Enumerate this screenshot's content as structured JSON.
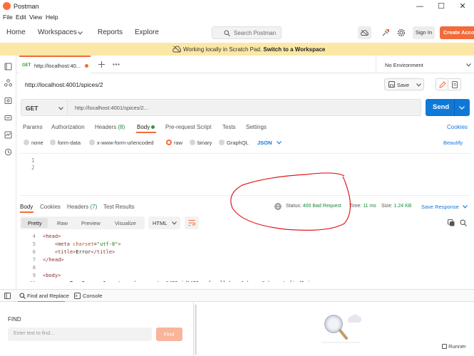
{
  "window": {
    "title": "Postman"
  },
  "menu": [
    "File",
    "Edit",
    "View",
    "Help"
  ],
  "header": {
    "nav": [
      "Home",
      "Workspaces",
      "Reports",
      "Explore"
    ],
    "search_placeholder": "Search Postman",
    "sign_in": "Sign In",
    "create_account": "Create Account"
  },
  "banner": {
    "text": "Working locally in Scratch Pad.",
    "link": "Switch to a Workspace"
  },
  "tab": {
    "method": "GET",
    "label": "http://localhost:40...",
    "environment": "No Environment"
  },
  "request": {
    "title": "http://localhost:4001/spices/2",
    "save_label": "Save",
    "method": "GET",
    "url": "http://localhost:4001/spices/2...",
    "send_label": "Send",
    "tabs": {
      "params": "Params",
      "authorization": "Authorization",
      "headers": "Headers",
      "headers_count": "(8)",
      "body": "Body",
      "prescript": "Pre-request Script",
      "tests": "Tests",
      "settings": "Settings",
      "cookies": "Cookies"
    },
    "body_types": [
      "none",
      "form-data",
      "x-www-form-urlencoded",
      "raw",
      "binary",
      "GraphQL"
    ],
    "body_format": "JSON",
    "beautify": "Beautify",
    "editor_lines": [
      "1",
      "2"
    ]
  },
  "response": {
    "tabs": {
      "body": "Body",
      "cookies": "Cookies",
      "headers": "Headers",
      "headers_count": "(7)",
      "test_results": "Test Results"
    },
    "status_label": "Status:",
    "status_value": "400 Bad Request",
    "time_label": "Time:",
    "time_value": "11 ms",
    "size_label": "Size:",
    "size_value": "1.24 KB",
    "save_response": "Save Response",
    "views": [
      "Pretty",
      "Raw",
      "Preview",
      "Visualize"
    ],
    "format": "HTML",
    "code": [
      {
        "n": "4",
        "parts": [
          [
            "tag",
            "<head>"
          ]
        ]
      },
      {
        "n": "5",
        "parts": [
          [
            "tag",
            "    <meta "
          ],
          [
            "attr",
            "charset"
          ],
          [
            "txt",
            "="
          ],
          [
            "str",
            "\"utf-8\""
          ],
          [
            "tag",
            ">"
          ]
        ]
      },
      {
        "n": "6",
        "parts": [
          [
            "tag",
            "    <title>"
          ],
          [
            "txt",
            "Error"
          ],
          [
            "tag",
            "</title>"
          ]
        ]
      },
      {
        "n": "7",
        "parts": [
          [
            "tag",
            "</head>"
          ]
        ]
      },
      {
        "n": "8",
        "parts": [
          [
            "txt",
            ""
          ]
        ]
      },
      {
        "n": "9",
        "parts": [
          [
            "tag",
            "<body>"
          ]
        ]
      },
      {
        "n": "10",
        "parts": [
          [
            "txt",
            "    <pre>TypeError: Cannot read property &#39;id&#39; of null<br> &nbsp; &nbsp;at findSpice"
          ]
        ]
      }
    ]
  },
  "bottom": {
    "find_replace": "Find and Replace",
    "console": "Console",
    "runner": "Runner"
  },
  "find": {
    "heading": "FIND",
    "placeholder": "Enter text to find...",
    "button": "Find"
  },
  "colors": {
    "accent": "#f26b3a",
    "send": "#0f79d8",
    "banner": "#fbe8a6",
    "status_ok_text": "#188b3a",
    "annotation": "#e0191f"
  }
}
